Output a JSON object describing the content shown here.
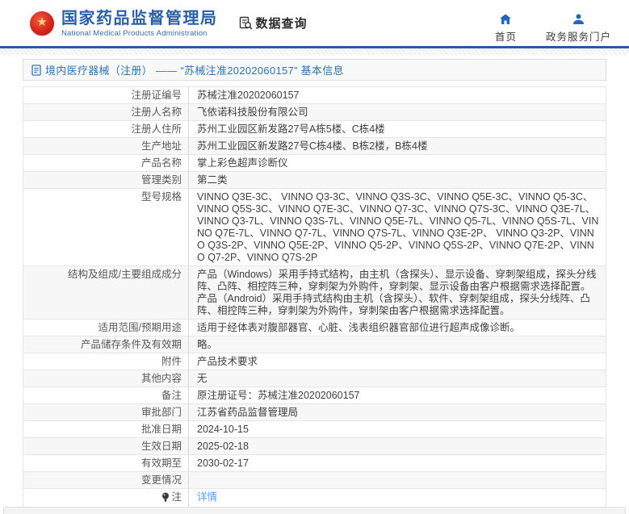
{
  "header": {
    "org_name_cn": "国家药品监督管理局",
    "org_name_en": "National Medical Products Administration",
    "data_query_label": "数据查询",
    "nav": [
      {
        "label": "首页",
        "icon": "home-icon"
      },
      {
        "label": "政务服务门户",
        "icon": "person-icon"
      }
    ]
  },
  "title_bar": {
    "text": "境内医疗器械（注册） ——  “苏械注准20202060157”  基本信息",
    "icon": "document-icon"
  },
  "table": {
    "rows": [
      {
        "label": "注册证编号",
        "value": "苏械注准20202060157"
      },
      {
        "label": "注册人名称",
        "value": "飞依诺科技股份有限公司"
      },
      {
        "label": "注册人住所",
        "value": "苏州工业园区新发路27号A栋5楼、C栋4楼"
      },
      {
        "label": "生产地址",
        "value": "苏州工业园区新发路27号C栋4楼、B栋2楼，B栋4楼"
      },
      {
        "label": "产品名称",
        "value": "掌上彩色超声诊断仪"
      },
      {
        "label": "管理类别",
        "value": "第二类"
      },
      {
        "label": "型号规格",
        "value": "VINNO Q3E-3C、 VINNO Q3-3C、VINNO Q3S-3C、VINNO Q5E-3C、VINNO Q5-3C、VINNO Q5S-3C、VINNO Q7E-3C、VINNO Q7-3C、VINNO Q7S-3C、VINNO Q3E-7L、 VINNO Q3-7L、VINNO Q3S-7L、VINNO Q5E-7L、VINNO Q5-7L、VINNO Q5S-7L、VINNO Q7E-7L、VINNO Q7-7L、VINNO Q7S-7L、VINNO Q3E-2P、 VINNO Q3-2P、VINNO Q3S-2P、VINNO Q5E-2P、VINNO Q5-2P、VINNO Q5S-2P、VINNO Q7E-2P、VINNO Q7-2P、VINNO Q7S-2P"
      },
      {
        "label": "结构及组成/主要组成成分",
        "value": "产品（Windows）采用手持式结构，由主机（含探头）、显示设备、穿刺架组成，探头分线阵、凸阵、相控阵三种，穿刺架为外购件，穿刺架、显示设备由客户根据需求选择配置。产品（Android）采用手持式结构由主机（含探头）、软件、穿刺架组成，探头分线阵、凸阵、相控阵三种，穿刺架为外购件，穿刺架由客户根据需求选择配置。"
      },
      {
        "label": "适用范围/预期用途",
        "value": "适用于经体表对腹部器官、心脏、浅表组织器官部位进行超声成像诊断。"
      },
      {
        "label": "产品储存条件及有效期",
        "value": "略。"
      },
      {
        "label": "附件",
        "value": "产品技术要求"
      },
      {
        "label": "其他内容",
        "value": "无"
      },
      {
        "label": "备注",
        "value": "原注册证号：苏械注准20202060157"
      },
      {
        "label": "审批部门",
        "value": "江苏省药品监督管理局"
      },
      {
        "label": "批准日期",
        "value": "2024-10-15"
      },
      {
        "label": "生效日期",
        "value": "2025-02-18"
      },
      {
        "label": "有效期至",
        "value": "2030-02-17"
      },
      {
        "label": "变更情况",
        "value": ""
      }
    ],
    "note_row": {
      "label": "注",
      "icon": "bulb-icon",
      "link_label": "详情"
    }
  },
  "colors": {
    "brand_blue": "#2b5fa7",
    "nav_icon_blue": "#2166c0",
    "title_blue": "#2d74b5",
    "link_blue": "#4f9df5",
    "header_rule_blue": "#2a5a9e",
    "emblem_red": "#d8241c",
    "stripe_gray": "#f7f7f7"
  }
}
